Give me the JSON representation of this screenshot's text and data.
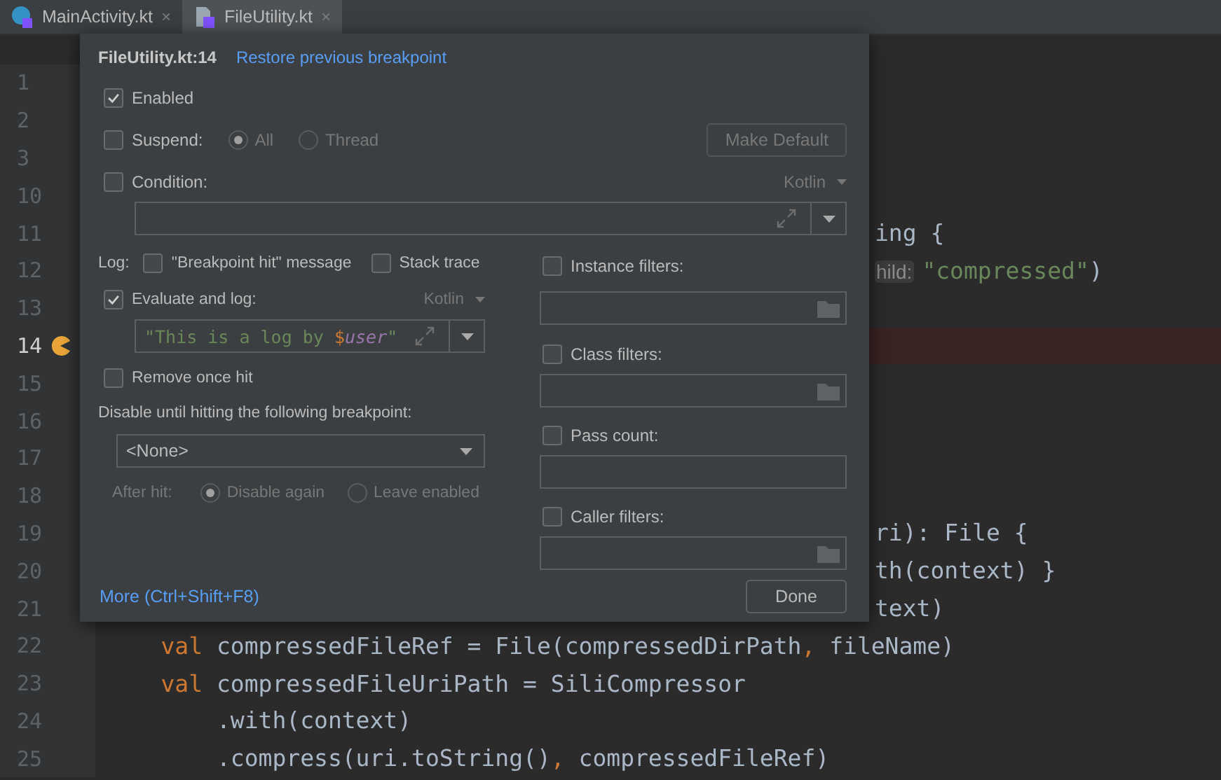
{
  "tabs": [
    {
      "label": "MainActivity.kt",
      "selected": false,
      "close": "×"
    },
    {
      "label": "FileUtility.kt",
      "selected": true,
      "close": "×"
    }
  ],
  "editor": {
    "lines": [
      {
        "number": "1",
        "kind": "tail",
        "breakpoint": false
      },
      {
        "number": "2",
        "kind": "tail",
        "breakpoint": false
      },
      {
        "number": "3",
        "kind": "tail",
        "breakpoint": false
      },
      {
        "number": "10",
        "kind": "tail",
        "breakpoint": false
      },
      {
        "number": "11",
        "kind": "tail",
        "breakpoint": false,
        "code": [
          {
            "text": "ing {",
            "kind": "plain"
          }
        ]
      },
      {
        "number": "12",
        "kind": "tail",
        "breakpoint": false,
        "code": [
          {
            "text": "hild:",
            "kind": "hint"
          },
          {
            "text": "\"compressed\"",
            "kind": "string"
          },
          {
            "text": ")",
            "kind": "plain"
          }
        ]
      },
      {
        "number": "13",
        "kind": "tail",
        "breakpoint": false
      },
      {
        "number": "14",
        "kind": "tail",
        "breakpoint": true
      },
      {
        "number": "15",
        "kind": "tail",
        "breakpoint": false
      },
      {
        "number": "16",
        "kind": "tail",
        "breakpoint": false
      },
      {
        "number": "17",
        "kind": "tail",
        "breakpoint": false
      },
      {
        "number": "18",
        "kind": "tail",
        "breakpoint": false
      },
      {
        "number": "19",
        "kind": "tail",
        "breakpoint": false,
        "code": [
          {
            "text": "ri): File {",
            "kind": "plain"
          }
        ]
      },
      {
        "number": "20",
        "kind": "tail",
        "breakpoint": false,
        "code": [
          {
            "text": "th(context) }",
            "kind": "plain"
          }
        ]
      },
      {
        "number": "21",
        "kind": "tail",
        "breakpoint": false,
        "code": [
          {
            "text": "text)",
            "kind": "plain"
          }
        ]
      },
      {
        "number": "22",
        "kind": "full",
        "breakpoint": false,
        "code": [
          {
            "text": "    val",
            "kind": "keyword"
          },
          {
            "text": " compressedFileRef = File(compressedDirPath",
            "kind": "plain"
          },
          {
            "text": ",",
            "kind": "punct"
          },
          {
            "text": " fileName)",
            "kind": "plain"
          }
        ]
      },
      {
        "number": "23",
        "kind": "full",
        "breakpoint": false,
        "code": [
          {
            "text": "    val",
            "kind": "keyword"
          },
          {
            "text": " compressedFileUriPath = SiliCompressor",
            "kind": "plain"
          }
        ]
      },
      {
        "number": "24",
        "kind": "full",
        "breakpoint": false,
        "code": [
          {
            "text": "        .with(context)",
            "kind": "plain"
          }
        ]
      },
      {
        "number": "25",
        "kind": "full",
        "breakpoint": false,
        "code": [
          {
            "text": "        .compress(uri.toString()",
            "kind": "plain"
          },
          {
            "text": ",",
            "kind": "punct"
          },
          {
            "text": " compressedFileRef)",
            "kind": "plain"
          }
        ]
      }
    ]
  },
  "dialog": {
    "title": "FileUtility.kt:14",
    "restore_link": "Restore previous breakpoint",
    "enabled": {
      "label": "Enabled",
      "checked": true
    },
    "suspend": {
      "label": "Suspend:",
      "checked": false,
      "disabled": true,
      "options": [
        {
          "label": "All",
          "selected": true
        },
        {
          "label": "Thread",
          "selected": false
        }
      ]
    },
    "make_default": {
      "label": "Make Default",
      "disabled": true
    },
    "condition": {
      "label": "Condition:",
      "checked": false,
      "language": "Kotlin"
    },
    "log": {
      "label": "Log:",
      "options": [
        {
          "label": "\"Breakpoint hit\" message",
          "checked": false
        },
        {
          "label": "Stack trace",
          "checked": false
        }
      ]
    },
    "evaluate": {
      "label": "Evaluate and log:",
      "checked": true,
      "language": "Kotlin",
      "expression": [
        {
          "text": "\"This is a log by ",
          "kind": "string"
        },
        {
          "text": "$",
          "kind": "dollar"
        },
        {
          "text": "user",
          "kind": "var"
        },
        {
          "text": "\"",
          "kind": "string"
        }
      ]
    },
    "remove_once_hit": {
      "label": "Remove once hit",
      "checked": false
    },
    "disable_until": {
      "label": "Disable until hitting the following breakpoint:",
      "value": "<None>"
    },
    "after_hit": {
      "label": "After hit:",
      "disabled": true,
      "options": [
        {
          "label": "Disable again",
          "selected": true
        },
        {
          "label": "Leave enabled",
          "selected": false
        }
      ]
    },
    "filters": [
      {
        "label": "Instance filters:",
        "checked": false,
        "browse": true
      },
      {
        "label": "Class filters:",
        "checked": false,
        "browse": true
      },
      {
        "label": "Pass count:",
        "checked": false,
        "browse": false
      },
      {
        "label": "Caller filters:",
        "checked": false,
        "browse": true
      }
    ],
    "more_link": "More (Ctrl+Shift+F8)",
    "done": {
      "label": "Done"
    }
  }
}
